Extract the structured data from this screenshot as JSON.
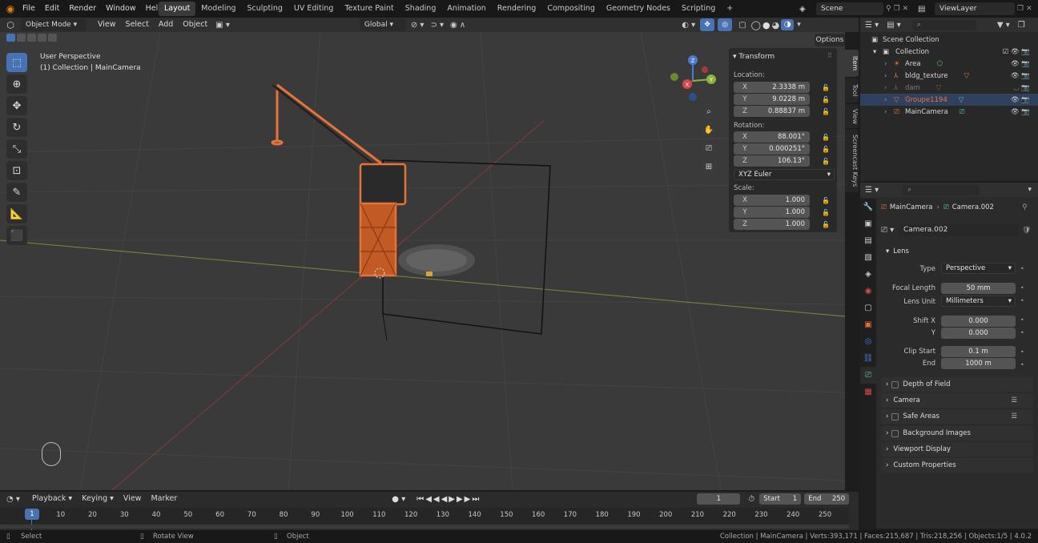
{
  "menus": [
    "File",
    "Edit",
    "Render",
    "Window",
    "Help"
  ],
  "workspaces": [
    "Layout",
    "Modeling",
    "Sculpting",
    "UV Editing",
    "Texture Paint",
    "Shading",
    "Animation",
    "Rendering",
    "Compositing",
    "Geometry Nodes",
    "Scripting"
  ],
  "active_workspace": "Layout",
  "add_tab": "+",
  "scene": "Scene",
  "view_layer": "ViewLayer",
  "viewport_header": {
    "mode": "Object Mode",
    "menus": [
      "View",
      "Select",
      "Add",
      "Object"
    ],
    "orientation": "Global",
    "options": "Options"
  },
  "viewport_overlay": {
    "perspective": "User Perspective",
    "collection_info": "(1) Collection | MainCamera"
  },
  "gizmo": {
    "x": "X",
    "y": "Y",
    "z": "Z"
  },
  "n_panel": {
    "title": "Transform",
    "location_label": "Location:",
    "location": [
      {
        "axis": "X",
        "value": "2.3338 m"
      },
      {
        "axis": "Y",
        "value": "9.0228 m"
      },
      {
        "axis": "Z",
        "value": "0.88837 m"
      }
    ],
    "rotation_label": "Rotation:",
    "rotation": [
      {
        "axis": "X",
        "value": "88.001°"
      },
      {
        "axis": "Y",
        "value": "0.000251°"
      },
      {
        "axis": "Z",
        "value": "106.13°"
      }
    ],
    "rotation_mode": "XYZ Euler",
    "scale_label": "Scale:",
    "scale": [
      {
        "axis": "X",
        "value": "1.000"
      },
      {
        "axis": "Y",
        "value": "1.000"
      },
      {
        "axis": "Z",
        "value": "1.000"
      }
    ],
    "side_tabs": [
      "Item",
      "Tool",
      "View",
      "Screencast Keys"
    ]
  },
  "outliner": {
    "root": "Scene Collection",
    "collection": "Collection",
    "items": [
      {
        "name": "Area",
        "color": "#d8d8d8",
        "selected": false
      },
      {
        "name": "bldg_texture",
        "color": "#d8d8d8",
        "selected": false
      },
      {
        "name": "dam",
        "color": "#7a7a7a",
        "selected": false
      },
      {
        "name": "Groupe1194",
        "color": "#e8733a",
        "selected": true
      },
      {
        "name": "MainCamera",
        "color": "#d8d8d8",
        "selected": false
      }
    ]
  },
  "properties": {
    "breadcrumb_object": "MainCamera",
    "breadcrumb_data": "Camera.002",
    "datablock": "Camera.002",
    "lens_section": "Lens",
    "type_label": "Type",
    "type_value": "Perspective",
    "focal_label": "Focal Length",
    "focal_value": "50 mm",
    "lens_unit_label": "Lens Unit",
    "lens_unit_value": "Millimeters",
    "shift_x_label": "Shift X",
    "shift_x_value": "0.000",
    "shift_y_label": "Y",
    "shift_y_value": "0.000",
    "clip_start_label": "Clip Start",
    "clip_start_value": "0.1 m",
    "clip_end_label": "End",
    "clip_end_value": "1000 m",
    "sections": [
      "Depth of Field",
      "Camera",
      "Safe Areas",
      "Background Images",
      "Viewport Display",
      "Custom Properties"
    ]
  },
  "timeline": {
    "menus": [
      "Playback",
      "Keying",
      "View",
      "Marker"
    ],
    "current_frame": "1",
    "start_label": "Start",
    "start_value": "1",
    "end_label": "End",
    "end_value": "250",
    "ticks": [
      "1",
      "10",
      "20",
      "30",
      "40",
      "50",
      "60",
      "70",
      "80",
      "90",
      "100",
      "110",
      "120",
      "130",
      "140",
      "150",
      "160",
      "170",
      "180",
      "190",
      "200",
      "210",
      "220",
      "230",
      "240",
      "250"
    ]
  },
  "status": {
    "select": "Select",
    "rotate": "Rotate View",
    "object": "Object",
    "stats": "Collection | MainCamera | Verts:393,171 | Faces:215,687 | Tris:218,256 | Objects:1/5 | 4.0.2"
  },
  "colors": {
    "accent": "#4772b3",
    "selection_orange": "#e8733a",
    "x_axis": "#d8474b",
    "y_axis": "#8ab53a",
    "z_axis": "#4a7bd4"
  }
}
